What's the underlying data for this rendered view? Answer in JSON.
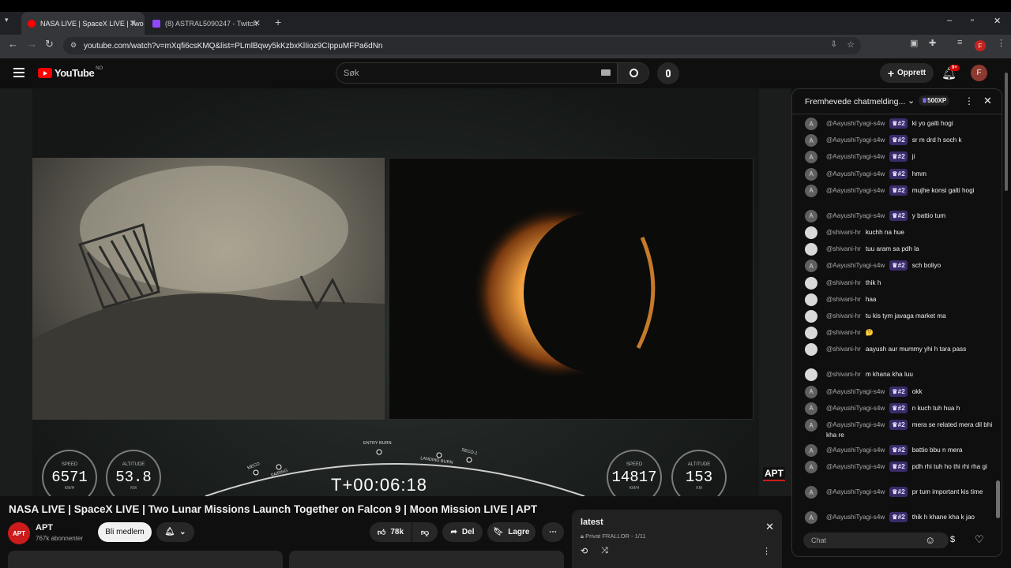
{
  "browser": {
    "tabs": [
      {
        "label": "NASA LIVE | SpaceX LIVE | Two",
        "active": true,
        "favicon_color": "#ff0000"
      },
      {
        "label": "(8) ASTRAL5090247 - Twitch",
        "active": false,
        "favicon_color": "#9146ff"
      }
    ],
    "url": "youtube.com/watch?v=mXqfi6csKMQ&list=PLmlBqwy5kKzbxKlIioz9CIppuMFPa6dNn",
    "profile_initial": "F",
    "new_tab_symbol": "+"
  },
  "youtube": {
    "logo": "YouTube",
    "region": "NO",
    "search_placeholder": "Søk",
    "create_label": "Opprett",
    "notifications_badge": "9+",
    "avatar_initial": "F"
  },
  "video": {
    "title": "NASA LIVE | SpaceX LIVE | Two Lunar Missions Launch Together on Falcon 9 | Moon Mission LIVE | APT",
    "telemetry_left": {
      "speed_label": "SPEED",
      "speed": "6571",
      "speed_unit": "KM/H",
      "altitude_label": "ALTITUDE",
      "altitude": "53.8",
      "altitude_unit": "KM"
    },
    "telemetry_right": {
      "speed_label": "SPEED",
      "speed": "14817",
      "speed_unit": "KM/H",
      "altitude_label": "ALTITUDE",
      "altitude": "153",
      "altitude_unit": "KM"
    },
    "clock": "T+00:06:18",
    "events": {
      "meco": "MECO",
      "fairing": "FAIRING",
      "entry": "ENTRY BURN",
      "landing": "LANDING BURN",
      "seco": "SECO-1"
    },
    "overlay_logo": "APT",
    "accent_color": "#cc1b1b"
  },
  "channel": {
    "name": "APT",
    "avatar_text": "APT",
    "subscribers": "767k abonnenter",
    "join_label": "Bli medlem"
  },
  "actions": {
    "likes": "78k",
    "share_label": "Del",
    "save_label": "Lagre"
  },
  "playlist": {
    "title": "latest",
    "meta": "Privat FRALLOR - 1/11"
  },
  "chat": {
    "header": "Fremhevede chatmelding...",
    "xp_label": "500XP",
    "input_placeholder": "Chat",
    "messages": [
      {
        "author": "@AayushiTyagi-s4w",
        "badge": "#2",
        "text": "ki yo galti hogi",
        "avatar": "A"
      },
      {
        "author": "@AayushiTyagi-s4w",
        "badge": "#2",
        "text": "sr m drd h soch k",
        "avatar": "A"
      },
      {
        "author": "@AayushiTyagi-s4w",
        "badge": "#2",
        "text": "ji",
        "avatar": "A"
      },
      {
        "author": "@AayushiTyagi-s4w",
        "badge": "#2",
        "text": "hmm",
        "avatar": "A"
      },
      {
        "author": "@AayushiTyagi-s4w",
        "badge": "#2",
        "text": "mujhe konsi galti hogi",
        "avatar": "A"
      },
      {
        "author": "@AayushiTyagi-s4w",
        "badge": "#2",
        "text": "y battio tum",
        "avatar": "A"
      },
      {
        "author": "@shivani-hr",
        "badge": "",
        "text": "kuchh na hue",
        "avatar": ""
      },
      {
        "author": "@shivani-hr",
        "badge": "",
        "text": "tuu aram sa pdh la",
        "avatar": ""
      },
      {
        "author": "@AayushiTyagi-s4w",
        "badge": "#2",
        "text": "sch boliyo",
        "avatar": "A"
      },
      {
        "author": "@shivani-hr",
        "badge": "",
        "text": "thik h",
        "avatar": ""
      },
      {
        "author": "@shivani-hr",
        "badge": "",
        "text": "haa",
        "avatar": ""
      },
      {
        "author": "@shivani-hr",
        "badge": "",
        "text": "tu kis tym javaga market ma",
        "avatar": ""
      },
      {
        "author": "@shivani-hr",
        "badge": "",
        "text": "🤔",
        "avatar": ""
      },
      {
        "author": "@shivani-hr",
        "badge": "",
        "text": "aayush aur mummy yhi h tara pass",
        "avatar": ""
      },
      {
        "author": "@shivani-hr",
        "badge": "",
        "text": "m khana kha luu",
        "avatar": ""
      },
      {
        "author": "@AayushiTyagi-s4w",
        "badge": "#2",
        "text": "okk",
        "avatar": "A"
      },
      {
        "author": "@AayushiTyagi-s4w",
        "badge": "#2",
        "text": "n kuch tuh hua h",
        "avatar": "A"
      },
      {
        "author": "@AayushiTyagi-s4w",
        "badge": "#2",
        "text": "mera se related mera dil bhi kha re",
        "avatar": "A"
      },
      {
        "author": "@AayushiTyagi-s4w",
        "badge": "#2",
        "text": "battio bbu n mera",
        "avatar": "A"
      },
      {
        "author": "@AayushiTyagi-s4w",
        "badge": "#2",
        "text": "pdh rhi tuh ho thi rhi rha gi",
        "avatar": "A"
      },
      {
        "author": "@AayushiTyagi-s4w",
        "badge": "#2",
        "text": "pr tum important kis time",
        "avatar": "A"
      },
      {
        "author": "@AayushiTyagi-s4w",
        "badge": "#2",
        "text": "thik h khane kha k jao",
        "avatar": "A"
      }
    ]
  }
}
